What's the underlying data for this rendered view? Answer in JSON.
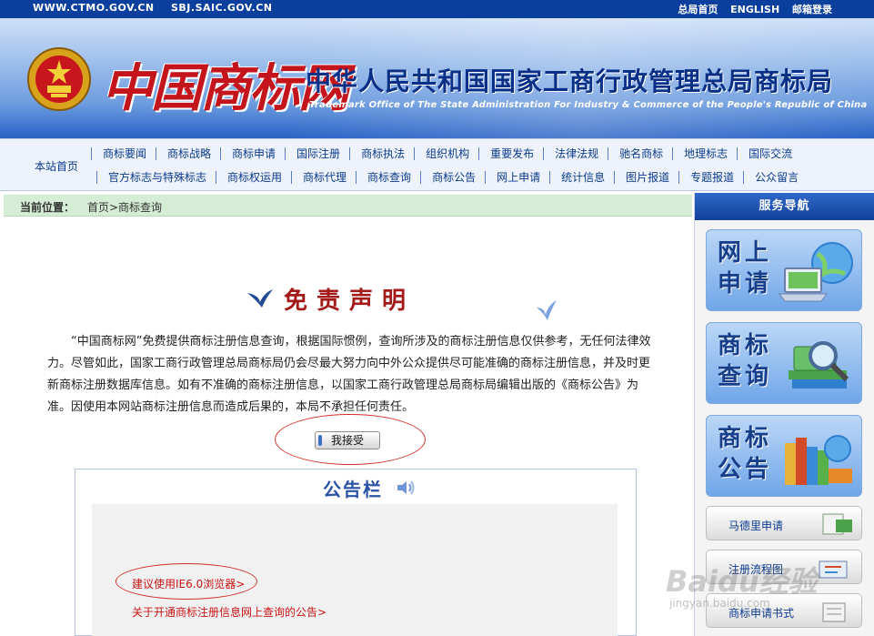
{
  "topbar": {
    "left_links": [
      "WWW.CTMO.GOV.CN",
      "SBJ.SAIC.GOV.CN"
    ],
    "right_links": [
      "总局首页",
      "ENGLISH",
      "邮箱登录"
    ]
  },
  "banner": {
    "logo_text": "中国商标网",
    "title": "中华人民共和国国家工商行政管理总局商标局",
    "subtitle": "Trademark Office of The State Administration For Industry & Commerce of the People's Republic of China"
  },
  "nav": {
    "home": "本站首页",
    "row1": [
      "商标要闻",
      "商标战略",
      "商标申请",
      "国际注册",
      "商标执法",
      "组织机构",
      "重要发布",
      "法律法规",
      "驰名商标",
      "地理标志",
      "国际交流"
    ],
    "row2": [
      "官方标志与特殊标志",
      "商标权运用",
      "商标代理",
      "商标查询",
      "商标公告",
      "网上申请",
      "统计信息",
      "图片报道",
      "专题报道",
      "公众留言"
    ]
  },
  "breadcrumb": {
    "label": "当前位置：",
    "path": "首页>商标查询"
  },
  "disclaimer": {
    "title": "免责声明",
    "text": "“中国商标网”免费提供商标注册信息查询，根据国际惯例，查询所涉及的商标注册信息仅供参考，无任何法律效力。尽管如此，国家工商行政管理总局商标局仍会尽最大努力向中外公众提供尽可能准确的商标注册信息，并及时更新商标注册数据库信息。如有不准确的商标注册信息，以国家工商行政管理总局商标局编辑出版的《商标公告》为准。因使用本网站商标注册信息而造成后果的，本局不承担任何责任。",
    "accept_button": "我接受"
  },
  "notice_board": {
    "title": "公告栏",
    "items": [
      "建议使用IE6.0浏览器>",
      "关于开通商标注册信息网上查询的公告>"
    ]
  },
  "sidebar": {
    "title": "服务导航",
    "big_buttons": [
      "网上申请",
      "商标查询",
      "商标公告"
    ],
    "small_buttons": [
      "马德里申请",
      "注册流程图",
      "商标申请书式"
    ]
  },
  "watermark": {
    "brand": "Baidu经验",
    "url": "jingyan.baidu.com"
  },
  "colors": {
    "topbar": "#0b3f9e",
    "nav_link": "#0b3a8c",
    "title_red": "#a31a1a",
    "link_red": "#c81414",
    "crumb_bg": "#d5ecd5",
    "sidebar_head": "#12409a"
  }
}
